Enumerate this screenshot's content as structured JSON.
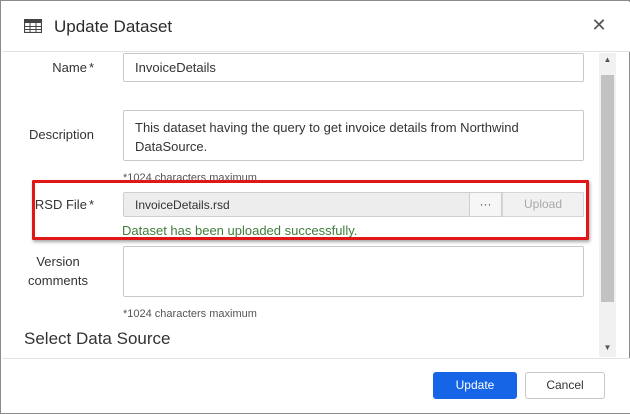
{
  "dialog": {
    "title": "Update Dataset",
    "header_icon": "table-icon",
    "close_icon": "close-icon",
    "close_glyph": "✕"
  },
  "form": {
    "name": {
      "label": "Name",
      "required_mark": "*",
      "value": "InvoiceDetails"
    },
    "description": {
      "label": "Description",
      "value": "This dataset having the query to get invoice details from Northwind DataSource.",
      "hint": "*1024 characters maximum"
    },
    "rsd_file": {
      "label": "RSD File",
      "required_mark": "*",
      "value": "InvoiceDetails.rsd",
      "browse_label": "···",
      "upload_label": "Upload",
      "success_message": "Dataset has been uploaded successfully."
    },
    "version_comments": {
      "label_line1": "Version",
      "label_line2": "comments",
      "value": "",
      "hint": "*1024 characters maximum"
    },
    "section_title": "Select Data Source"
  },
  "footer": {
    "update_label": "Update",
    "cancel_label": "Cancel"
  },
  "scrollbar": {
    "up_glyph": "▲",
    "down_glyph": "▼"
  },
  "colors": {
    "primary": "#1565e6",
    "success_text": "#3f7d3a",
    "highlight": "#e01717"
  }
}
